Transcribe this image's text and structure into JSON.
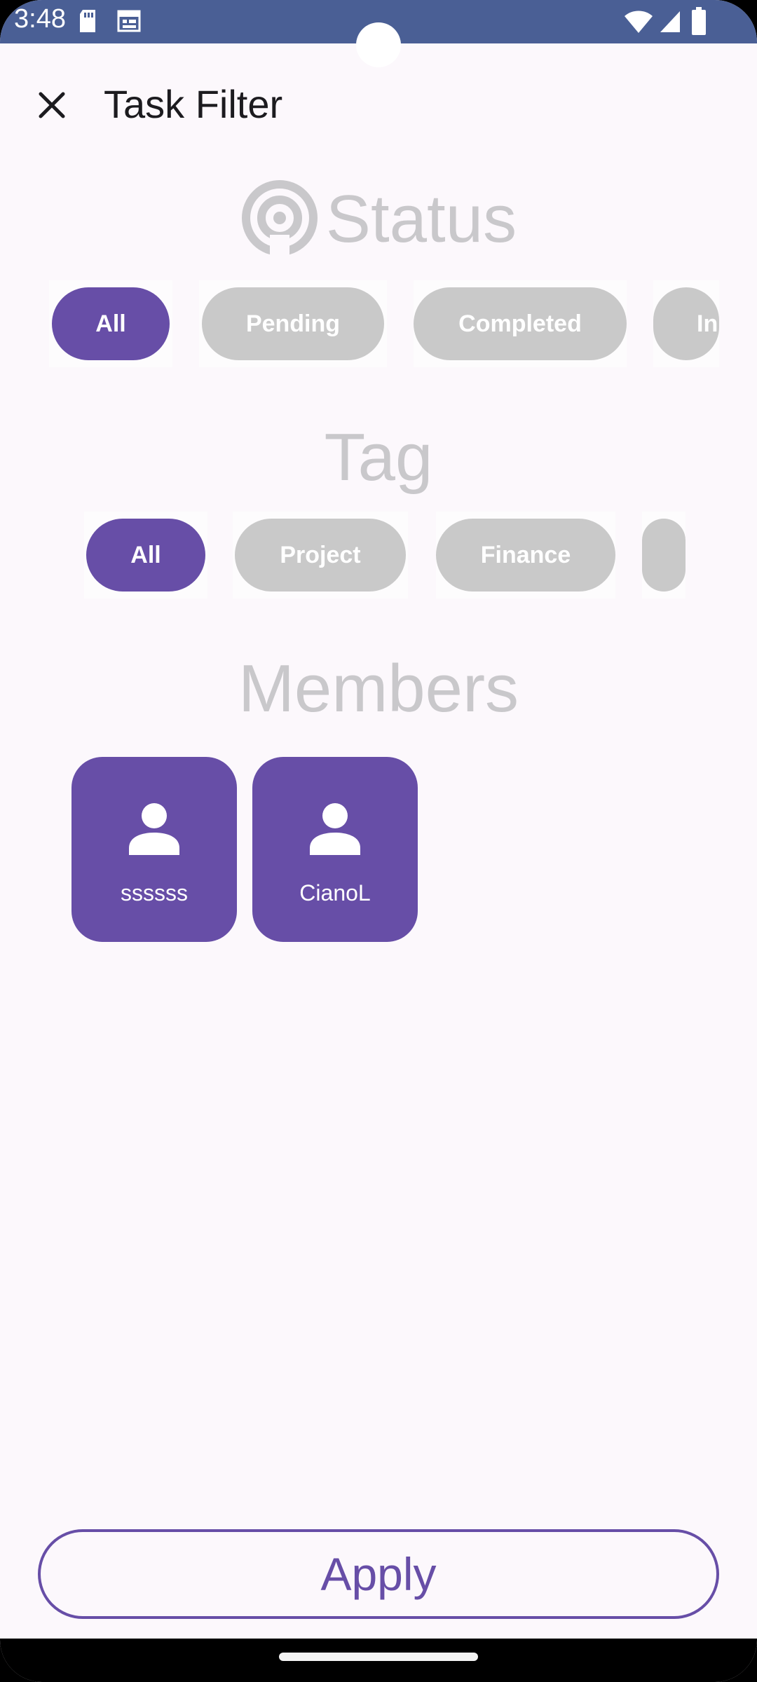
{
  "status_bar": {
    "time": "3:48",
    "left_icons": [
      "sd-card-icon",
      "calendar-icon"
    ],
    "right_icons": [
      "wifi-icon",
      "signal-icon",
      "battery-icon"
    ]
  },
  "header": {
    "title": "Task Filter",
    "close_icon": "close-icon"
  },
  "status_section": {
    "title": "Status",
    "icon": "broadcast-icon",
    "chips": [
      {
        "label": "All",
        "selected": true
      },
      {
        "label": "Pending",
        "selected": false
      },
      {
        "label": "Completed",
        "selected": false
      },
      {
        "label": "In",
        "selected": false
      }
    ]
  },
  "tag_section": {
    "title": "Tag",
    "chips": [
      {
        "label": "All",
        "selected": true
      },
      {
        "label": "Project",
        "selected": false
      },
      {
        "label": "Finance",
        "selected": false
      },
      {
        "label": "",
        "selected": false
      }
    ]
  },
  "members_section": {
    "title": "Members",
    "members": [
      {
        "name": "ssssss",
        "icon": "person-icon"
      },
      {
        "name": "CianoL",
        "icon": "person-icon"
      }
    ]
  },
  "footer": {
    "apply_label": "Apply"
  },
  "colors": {
    "accent": "#674ea7",
    "status_bar": "#4a5f95",
    "chip_unselected": "#c9c9c9",
    "section_title": "#c9c8cb",
    "background": "#fcf8fc"
  }
}
